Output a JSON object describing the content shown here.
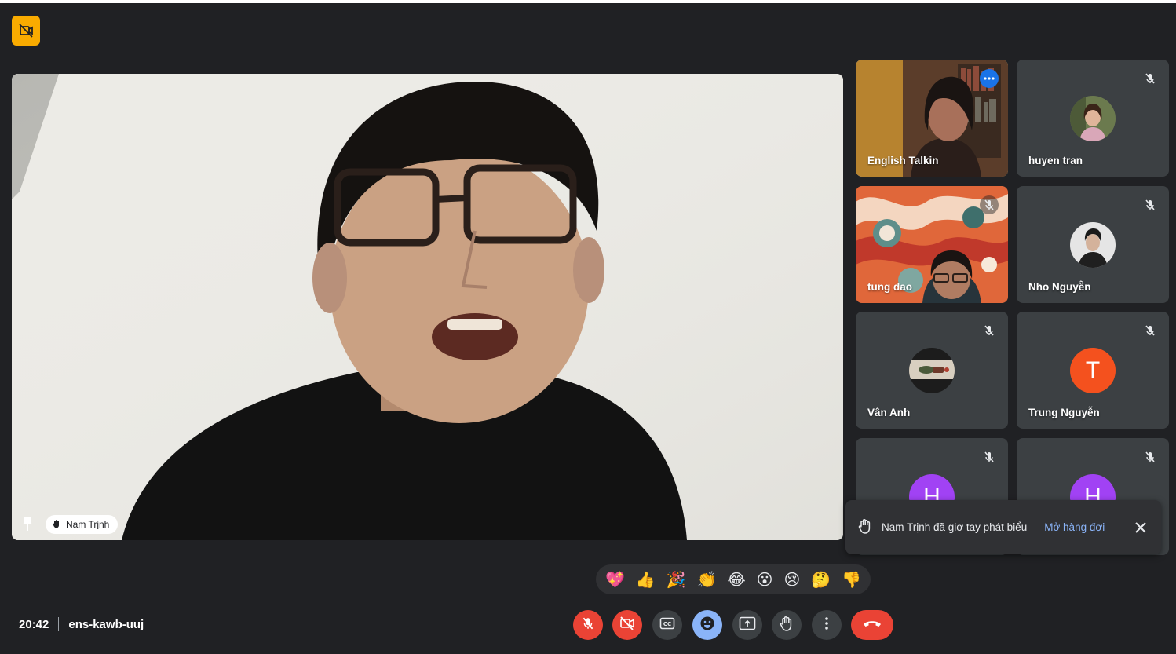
{
  "main": {
    "speaker_name": "Nam Trịnh"
  },
  "participants": [
    {
      "name": "English Talkin",
      "active": true
    },
    {
      "name": "huyen tran"
    },
    {
      "name": "tung dao"
    },
    {
      "name": "Nho Nguyễn"
    },
    {
      "name": "Vân Anh"
    },
    {
      "name": "Trung Nguyễn",
      "initial": "T",
      "color": "#f4511e"
    },
    {
      "initial": "H",
      "color": "#a142f4"
    },
    {
      "initial": "H",
      "color": "#a142f4"
    }
  ],
  "notification": {
    "text": "Nam Trịnh đã giơ tay phát biểu",
    "link": "Mở hàng đợi"
  },
  "reactions": [
    "💖",
    "👍",
    "🎉",
    "👏",
    "😂",
    "😮",
    "😢",
    "🤔",
    "👎"
  ],
  "meeting": {
    "time": "20:42",
    "code": "ens-kawb-uuj"
  },
  "colors": {
    "background": "#202124",
    "tile": "#3c4043",
    "accent": "#8ab4f8",
    "danger": "#ea4335",
    "warning": "#f9ab00"
  },
  "icons": {
    "top_badge": "no-video-captions-icon",
    "controls": [
      "mic-off-icon",
      "camera-off-icon",
      "captions-icon",
      "emoji-icon",
      "present-icon",
      "raise-hand-icon",
      "more-vert-icon",
      "end-call-icon"
    ]
  }
}
